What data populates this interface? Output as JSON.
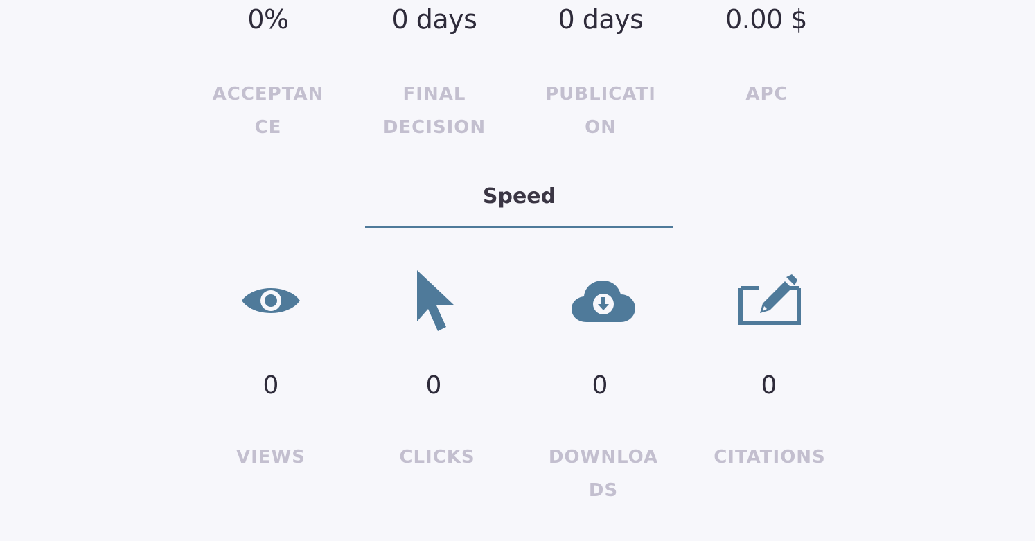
{
  "stats": [
    {
      "value": "0%",
      "label": "ACCEPTAN CE"
    },
    {
      "value": "0 days",
      "label": "FINAL DECISION"
    },
    {
      "value": "0 days",
      "label": "PUBLICATI ON"
    },
    {
      "value": "0.00 $",
      "label": "APC"
    }
  ],
  "section": {
    "title": "Speed"
  },
  "metrics": [
    {
      "icon": "eye-icon",
      "value": "0",
      "label": "VIEWS"
    },
    {
      "icon": "cursor-icon",
      "value": "0",
      "label": "CLICKS"
    },
    {
      "icon": "cloud-download-icon",
      "value": "0",
      "label": "DOWNLOA DS"
    },
    {
      "icon": "edit-icon",
      "value": "0",
      "label": "CITATIONS"
    }
  ],
  "colors": {
    "accent": "#4f7a9a",
    "label": "#c3bfcf",
    "value": "#2e2b3a"
  }
}
